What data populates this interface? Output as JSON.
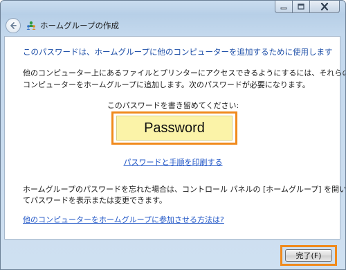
{
  "window": {
    "title": "ホームグループの作成",
    "caption_buttons": [
      "minimize-icon",
      "maximize-icon",
      "close-icon"
    ]
  },
  "content": {
    "heading": "このパスワードは、ホームグループに他のコンピューターを追加するために使用します",
    "description_line1": "他のコンピューター上にあるファイルとプリンターにアクセスできるようにするには、それらの",
    "description_line2": "コンピューターをホームグループに追加します。次のパスワードが必要になります。",
    "write_down_label": "このパスワードを書き留めてください:",
    "password": "Password",
    "print_link": "パスワードと手順を印刷する",
    "forgot_line1": "ホームグループのパスワードを忘れた場合は、コントロール パネルの [ホームグループ] を開い",
    "forgot_line2": "てパスワードを表示または変更できます。",
    "join_link": "他のコンピューターをホームグループに参加させる方法は?"
  },
  "footer": {
    "finish_label": "完了(F)"
  },
  "colors": {
    "highlight": "#f08a1c",
    "link": "#1f55c6",
    "heading": "#1e4fa8",
    "password_bg": "#fbf3a8"
  }
}
